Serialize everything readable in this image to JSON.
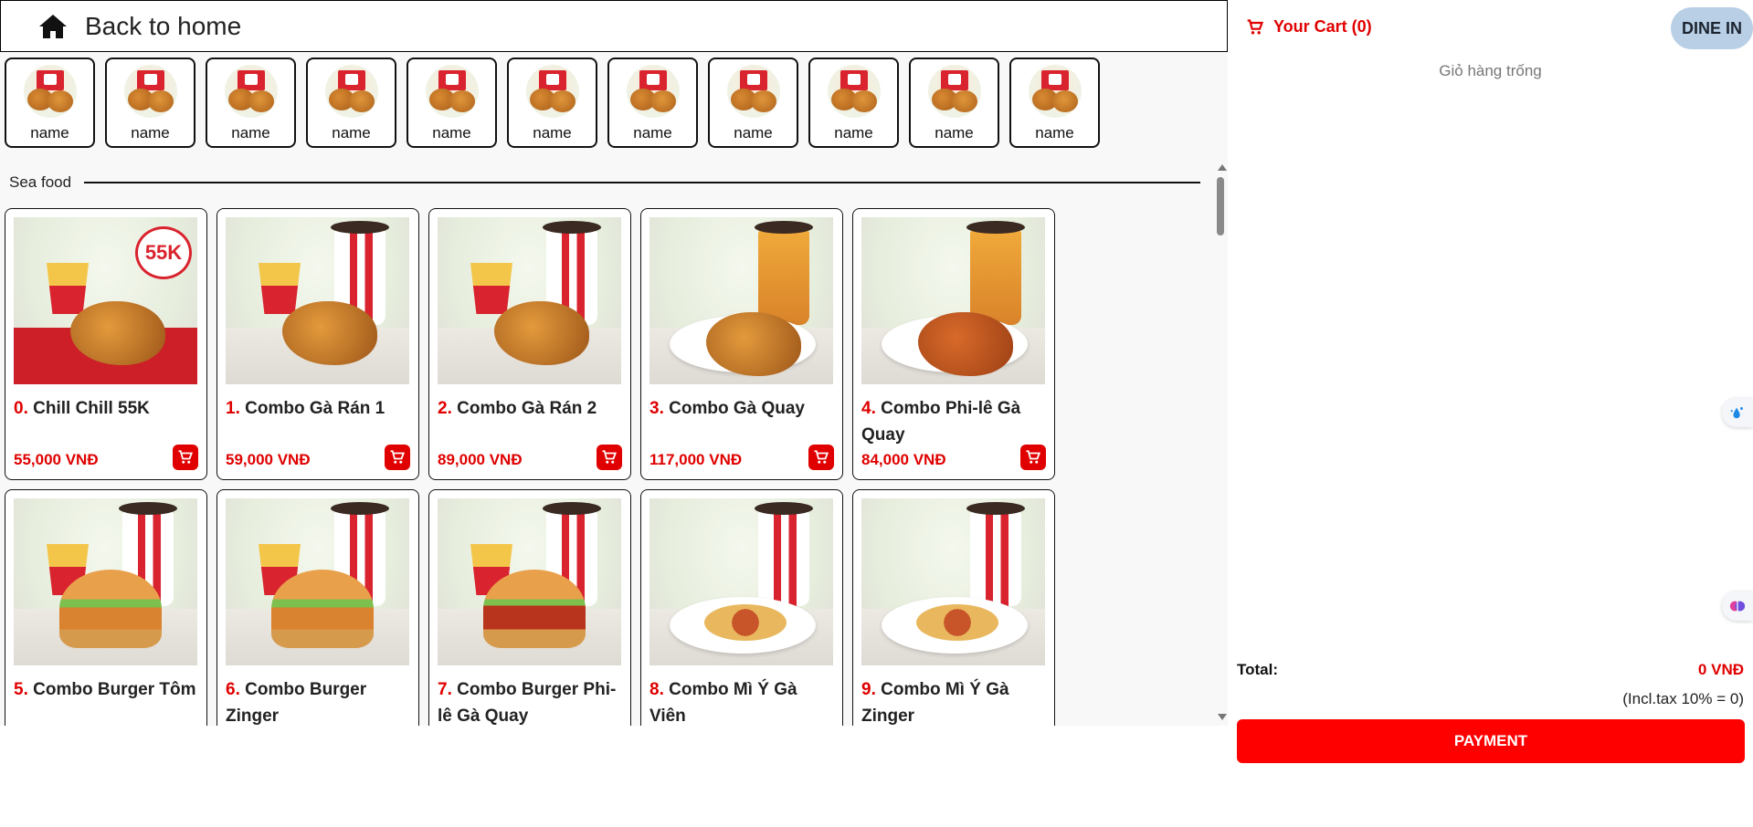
{
  "header": {
    "back_label": "Back to home",
    "icon": "home-icon"
  },
  "categories": [
    {
      "name": "name"
    },
    {
      "name": "name"
    },
    {
      "name": "name"
    },
    {
      "name": "name"
    },
    {
      "name": "name"
    },
    {
      "name": "name"
    },
    {
      "name": "name"
    },
    {
      "name": "name"
    },
    {
      "name": "name"
    },
    {
      "name": "name"
    },
    {
      "name": "name"
    }
  ],
  "section": {
    "title": "Sea food"
  },
  "products": [
    {
      "index": "0.",
      "name": "Chill Chill 55K",
      "price": "55,000 VNĐ",
      "promo": "55K"
    },
    {
      "index": "1.",
      "name": "Combo Gà Rán 1",
      "price": "59,000 VNĐ"
    },
    {
      "index": "2.",
      "name": "Combo Gà Rán 2",
      "price": "89,000 VNĐ"
    },
    {
      "index": "3.",
      "name": "Combo Gà Quay",
      "price": "117,000 VNĐ"
    },
    {
      "index": "4.",
      "name": "Combo Phi-lê Gà Quay",
      "price": "84,000 VNĐ"
    },
    {
      "index": "5.",
      "name": "Combo Burger Tôm",
      "price": ""
    },
    {
      "index": "6.",
      "name": "Combo Burger Zinger",
      "price": ""
    },
    {
      "index": "7.",
      "name": "Combo Burger Phi-lê Gà Quay",
      "price": ""
    },
    {
      "index": "8.",
      "name": "Combo Mì Ý Gà Viên",
      "price": ""
    },
    {
      "index": "9.",
      "name": "Combo Mì Ý Gà Zinger",
      "price": ""
    }
  ],
  "cart": {
    "title": "Your Cart (0)",
    "mode": "DINE IN",
    "empty_text": "Giỏ hàng trống",
    "total_label": "Total:",
    "total_value": "0 VNĐ",
    "tax_text": "(Incl.tax 10% = 0)",
    "payment_label": "PAYMENT"
  },
  "colors": {
    "accent": "#ff0000",
    "price": "#e00000",
    "dine_in_bg": "#b8cfe6"
  }
}
